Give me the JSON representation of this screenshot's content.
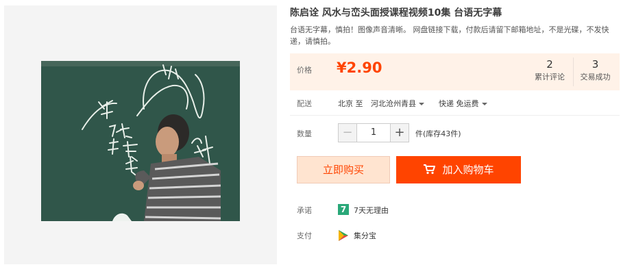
{
  "product": {
    "title": "陈启诠 风水与峦头面授课程视频10集 台语无字幕",
    "subtitle": "台语无字幕，慎拍！图像声音清晰。 网盘链接下载，付款后请留下邮箱地址，不是光碟，不发快递，请慎拍。"
  },
  "price": {
    "label": "价格",
    "value": "¥2.90",
    "reviews_count": "2",
    "reviews_label": "累计评论",
    "trades_count": "3",
    "trades_label": "交易成功"
  },
  "shipping": {
    "label": "配送",
    "from": "北京 至",
    "to": "河北沧州青县",
    "method": "快递 免运费"
  },
  "quantity": {
    "label": "数量",
    "minus": "−",
    "value": "1",
    "plus": "+",
    "stock": "件(库存43件)"
  },
  "actions": {
    "buy_now": "立即购买",
    "add_to_cart": "加入购物车"
  },
  "promise": {
    "label": "承诺",
    "icon_text": "7",
    "text": "7天无理由"
  },
  "payment": {
    "label": "支付",
    "text": "集分宝"
  },
  "colors": {
    "accent": "#ff4400",
    "price_bg": "#fff2e8",
    "buy_now_bg": "#ffe4d0",
    "promise_green": "#2aa879"
  },
  "icons": {
    "cart": "cart-icon",
    "promise": "seven-days-icon",
    "payment": "jifenbao-icon"
  }
}
